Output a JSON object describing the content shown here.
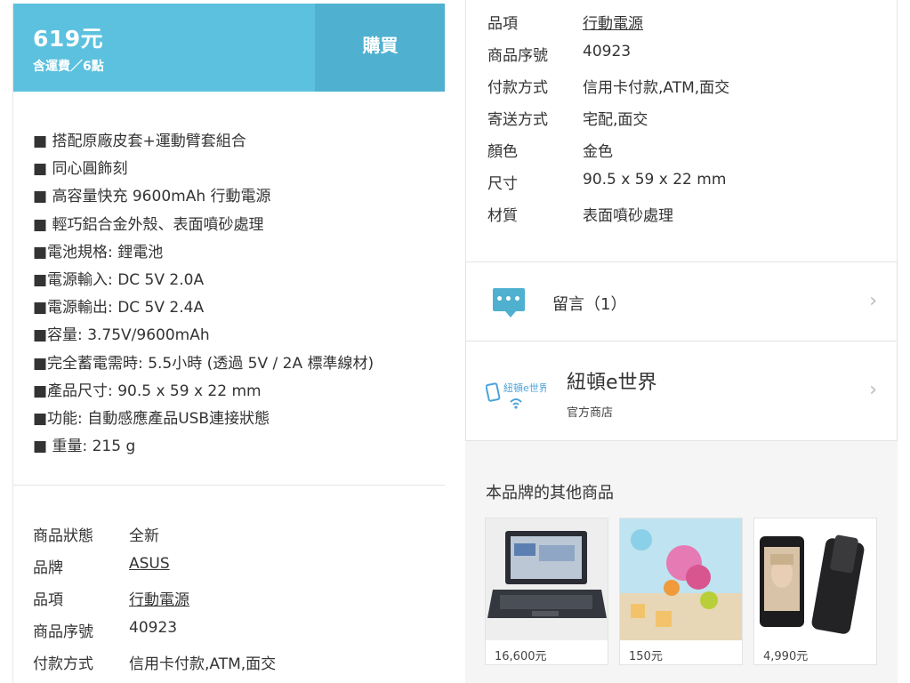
{
  "purchase": {
    "price": "619元",
    "price_note": "含運費／6點",
    "buy_label": "購買"
  },
  "features": [
    "■ 搭配原廠皮套+運動臂套組合",
    "■ 同心圓飾刻",
    "■ 高容量快充 9600mAh 行動電源",
    "■ 輕巧鋁合金外殼、表面噴砂處理",
    "■電池規格: 鋰電池",
    "■電源輸入: DC 5V 2.0A",
    "■電源輸出: DC 5V 2.4A",
    "■容量: 3.75V/9600mAh",
    "■完全蓄電需時: 5.5小時 (透過 5V / 2A 標準線材)",
    "■產品尺寸: 90.5 x 59 x 22 mm",
    "■功能: 自動感應產品USB連接狀態",
    "■ 重量: 215 g"
  ],
  "specs_left": [
    {
      "label": "商品狀態",
      "value": "全新"
    },
    {
      "label": "品牌",
      "value": "ASUS"
    },
    {
      "label": "品項",
      "value": "行動電源"
    },
    {
      "label": "商品序號",
      "value": "40923"
    },
    {
      "label": "付款方式",
      "value": "信用卡付款,ATM,面交"
    }
  ],
  "specs_right": [
    {
      "label": "品項",
      "value": "行動電源"
    },
    {
      "label": "商品序號",
      "value": "40923"
    },
    {
      "label": "付款方式",
      "value": "信用卡付款,ATM,面交"
    },
    {
      "label": "寄送方式",
      "value": "宅配,面交"
    },
    {
      "label": "顏色",
      "value": "金色"
    },
    {
      "label": "尺寸",
      "value": "90.5 x 59 x 22 mm"
    },
    {
      "label": "材質",
      "value": "表面噴砂處理"
    }
  ],
  "comments": {
    "label": "留言（1）",
    "icon": "comment-dots-icon"
  },
  "shop": {
    "name": "紐頓e世界",
    "type": "官方商店",
    "logo_text": "紐頓e世界"
  },
  "related": {
    "title": "本品牌的其他商品",
    "items": [
      {
        "price": "16,600元"
      },
      {
        "price": "150元"
      },
      {
        "price": "4,990元"
      }
    ]
  },
  "colors": {
    "accent": "#5cc1de",
    "accent_dark": "#4fb1cf"
  }
}
